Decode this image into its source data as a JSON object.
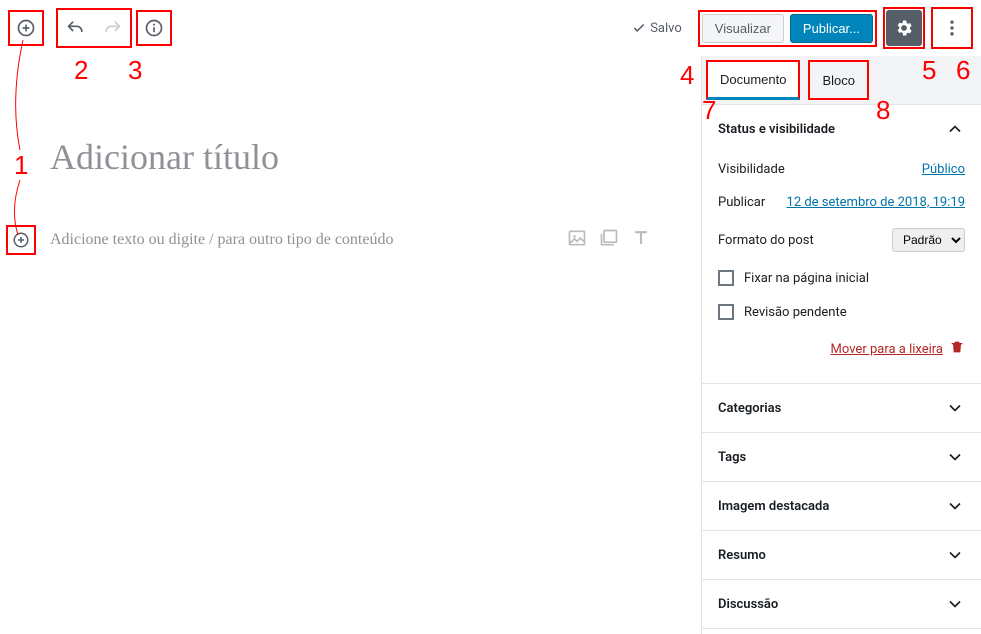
{
  "toolbar": {
    "saved_label": "Salvo",
    "preview_label": "Visualizar",
    "publish_label": "Publicar..."
  },
  "editor": {
    "title_placeholder": "Adicionar título",
    "block_placeholder": "Adicione texto ou digite / para outro tipo de conteúdo"
  },
  "sidebar": {
    "tabs": {
      "document": "Documento",
      "block": "Bloco"
    },
    "status": {
      "header": "Status e visibilidade",
      "visibility_label": "Visibilidade",
      "visibility_value": "Público",
      "publish_label": "Publicar",
      "publish_value": "12 de setembro de 2018, 19:19",
      "format_label": "Formato do post",
      "format_value": "Padrão",
      "stick_label": "Fixar na página inicial",
      "pending_label": "Revisão pendente",
      "trash_label": "Mover para a lixeira"
    },
    "panels": {
      "categories": "Categorias",
      "tags": "Tags",
      "featured": "Imagem destacada",
      "excerpt": "Resumo",
      "discussion": "Discussão"
    }
  },
  "annotations": {
    "n1": "1",
    "n2": "2",
    "n3": "3",
    "n4": "4",
    "n5": "5",
    "n6": "6",
    "n7": "7",
    "n8": "8"
  }
}
